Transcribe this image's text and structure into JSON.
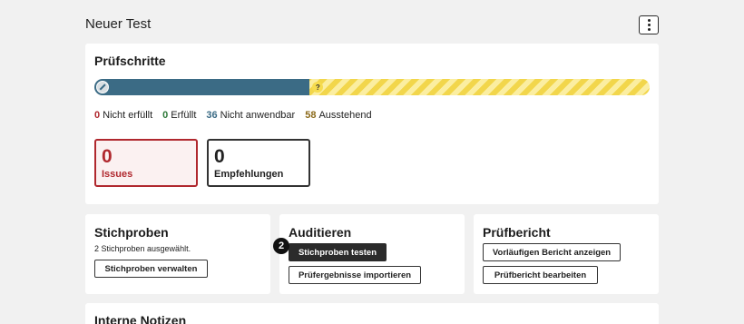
{
  "page": {
    "title": "Neuer Test",
    "menu_icon": "kebab-menu-icon"
  },
  "steps": {
    "heading": "Prüfschritte",
    "progress": {
      "done_fraction": 0.3878,
      "done_icon": "not-applicable-icon",
      "pending_icon_text": "?",
      "colors": {
        "done": "#3b6b85",
        "pending": "#f2d64b"
      }
    },
    "stats": [
      {
        "count": "0",
        "label": "Nicht erfüllt",
        "color": "#b0282e"
      },
      {
        "count": "0",
        "label": "Erfüllt",
        "color": "#2f7a3a"
      },
      {
        "count": "36",
        "label": "Nicht anwendbar",
        "color": "#3b6b85"
      },
      {
        "count": "58",
        "label": "Ausstehend",
        "color": "#8b6a1a"
      }
    ],
    "issues": {
      "count": "0",
      "label": "Issues"
    },
    "recommendations": {
      "count": "0",
      "label": "Empfehlungen"
    }
  },
  "samples": {
    "heading": "Stichproben",
    "subtext": "2 Stichproben ausgewählt.",
    "manage_button": "Stichproben verwalten"
  },
  "audit": {
    "heading": "Auditieren",
    "step_badge": "2",
    "test_button": "Stichproben testen",
    "import_button": "Prüfergebnisse importieren"
  },
  "report": {
    "heading": "Prüfbericht",
    "preview_button": "Vorläufigen Bericht anzeigen",
    "edit_button": "Prüfbericht bearbeiten"
  },
  "notes": {
    "heading": "Interne Notizen"
  }
}
